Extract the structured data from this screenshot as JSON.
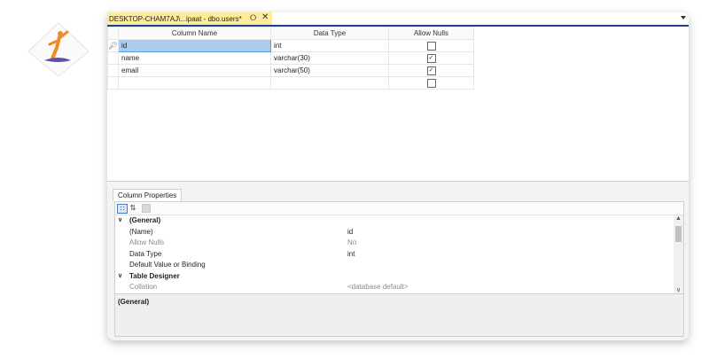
{
  "colors": {
    "tab_active": "#ffec9b",
    "accent_line": "#1f3f8f",
    "selection": "#a9cdf0"
  },
  "tab": {
    "title": "DESKTOP-CHAM7AJ\\...ipaat - dbo.users*",
    "pin_icon": "pin-icon",
    "close_icon": "close-icon"
  },
  "grid": {
    "headers": {
      "name": "Column Name",
      "type": "Data Type",
      "nulls": "Allow Nulls"
    },
    "rows": [
      {
        "name": "id",
        "type": "int",
        "allow_nulls": false,
        "primary_key": true
      },
      {
        "name": "name",
        "type": "varchar(30)",
        "allow_nulls": true
      },
      {
        "name": "email",
        "type": "varchar(50)",
        "allow_nulls": true
      },
      {
        "name": "",
        "type": "",
        "allow_nulls": false
      }
    ]
  },
  "properties": {
    "tab_label": "Column Properties",
    "categories": [
      {
        "label": "(General)",
        "items": [
          {
            "name": "(Name)",
            "value": "id",
            "dim": false
          },
          {
            "name": "Allow Nulls",
            "value": "No",
            "dim": true
          },
          {
            "name": "Data Type",
            "value": "int",
            "dim": false
          },
          {
            "name": "Default Value or Binding",
            "value": "",
            "dim": false
          }
        ]
      },
      {
        "label": "Table Designer",
        "items": [
          {
            "name": "Collation",
            "value": "<database default>",
            "dim": true
          }
        ]
      }
    ],
    "description_title": "(General)"
  }
}
